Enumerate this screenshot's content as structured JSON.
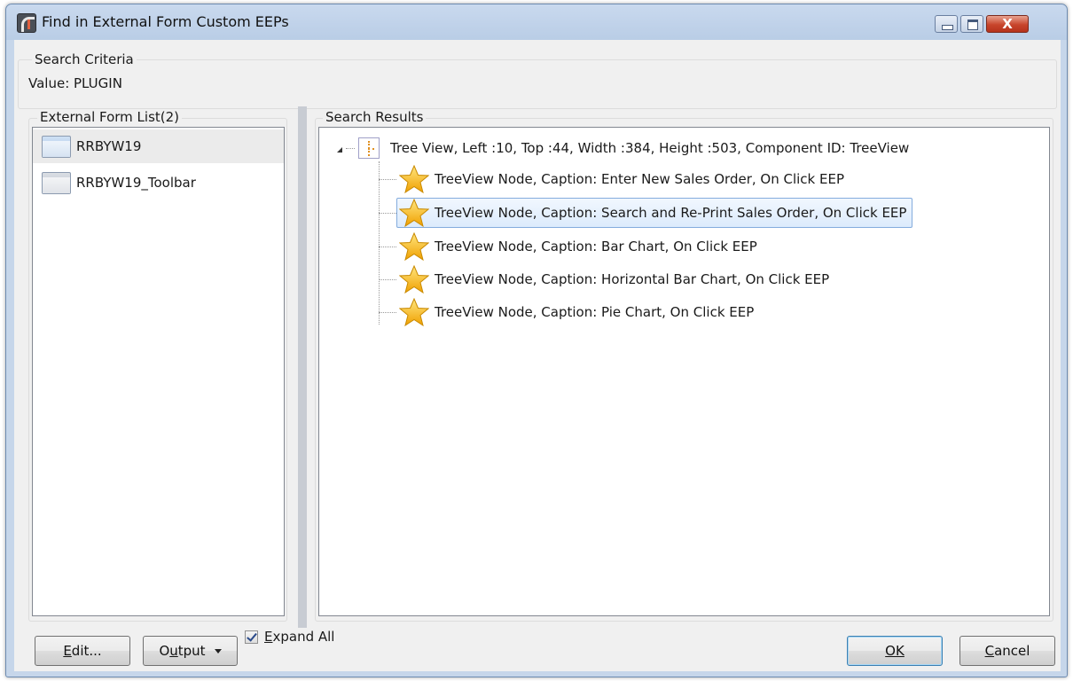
{
  "window": {
    "title": "Find in External Form Custom EEPs",
    "controls": {
      "minimize": "minimize",
      "maximize": "maximize",
      "close": "X"
    }
  },
  "criteria": {
    "legend": "Search Criteria",
    "value_text": "Value: PLUGIN"
  },
  "form_list": {
    "legend": "External Form List(2)",
    "items": [
      {
        "label": "RRBYW19",
        "icon": "form-icon",
        "selected": true
      },
      {
        "label": "RRBYW19_Toolbar",
        "icon": "form-toolbar-icon",
        "selected": false
      }
    ]
  },
  "results": {
    "legend": "Search Results",
    "root": {
      "label": "Tree View, Left :10, Top :44, Width :384, Height :503, Component ID: TreeView",
      "icon": "treeview-icon",
      "expanded": true
    },
    "nodes": [
      {
        "label": "TreeView Node, Caption: Enter New Sales Order, On Click EEP",
        "icon": "star-icon",
        "selected": false
      },
      {
        "label": "TreeView Node, Caption: Search and Re-Print Sales Order, On Click EEP",
        "icon": "star-icon",
        "selected": true
      },
      {
        "label": "TreeView Node, Caption: Bar Chart, On Click EEP",
        "icon": "star-icon",
        "selected": false
      },
      {
        "label": "TreeView Node, Caption: Horizontal Bar Chart, On Click EEP",
        "icon": "star-icon",
        "selected": false
      },
      {
        "label": "TreeView Node, Caption: Pie Chart, On Click EEP",
        "icon": "star-icon",
        "selected": false
      }
    ]
  },
  "footer": {
    "edit_label_accel": "E",
    "edit_label_rest": "dit...",
    "output_label_pre": "O",
    "output_label_accel": "u",
    "output_label_rest": "tput",
    "expand_all_accel": "E",
    "expand_all_rest": "xpand All",
    "expand_all_checked": true,
    "ok_label": "OK",
    "cancel_label_accel": "C",
    "cancel_label_rest": "ancel"
  },
  "colors": {
    "selection_border": "#84acdd",
    "selection_fill": "#dcebfc",
    "star": "#f5b400",
    "close_button": "#c8452c"
  }
}
